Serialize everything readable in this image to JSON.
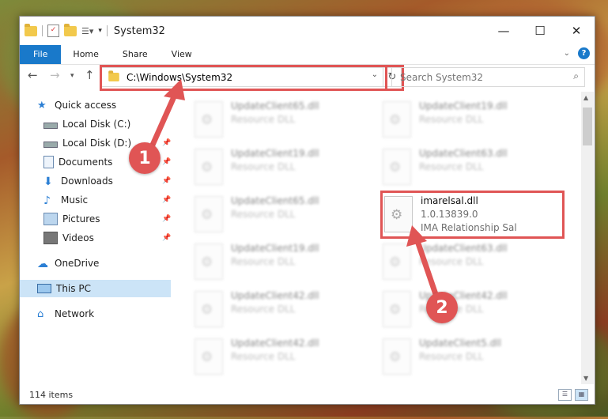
{
  "window": {
    "title": "System32"
  },
  "ribbon": {
    "tabs": [
      "File",
      "Home",
      "Share",
      "View"
    ]
  },
  "address": {
    "path": "C:\\Windows\\System32"
  },
  "search": {
    "placeholder": "Search System32"
  },
  "sidebar": {
    "items": [
      {
        "label": "Quick access",
        "icon": "star-icon"
      },
      {
        "label": "Local Disk (C:)",
        "icon": "drive-icon"
      },
      {
        "label": "Local Disk (D:)",
        "icon": "drive-icon"
      },
      {
        "label": "Documents",
        "icon": "documents-icon"
      },
      {
        "label": "Downloads",
        "icon": "download-icon"
      },
      {
        "label": "Music",
        "icon": "music-icon"
      },
      {
        "label": "Pictures",
        "icon": "pictures-icon"
      },
      {
        "label": "Videos",
        "icon": "videos-icon"
      },
      {
        "label": "OneDrive",
        "icon": "cloud-icon"
      },
      {
        "label": "This PC",
        "icon": "computer-icon"
      },
      {
        "label": "Network",
        "icon": "network-icon"
      }
    ]
  },
  "files": [
    {
      "name": "UpdateClient65.dll",
      "type": "Resource DLL"
    },
    {
      "name": "UpdateClient19.dll",
      "type": "Resource DLL"
    },
    {
      "name": "UpdateClient19.dll",
      "type": "Resource DLL"
    },
    {
      "name": "UpdateClient63.dll",
      "type": "Resource DLL"
    },
    {
      "name": "UpdateClient65.dll",
      "type": "Resource DLL"
    },
    {
      "name": "UpdateClient19.dll",
      "type": "Resource DLL"
    },
    {
      "name": "UpdateClient63.dll",
      "type": "Resource DLL"
    },
    {
      "name": "UpdateClient42.dll",
      "type": "Resource DLL"
    },
    {
      "name": "UpdateClient42.dll",
      "type": "Resource DLL"
    },
    {
      "name": "UpdateClient42.dll",
      "type": "Resource DLL"
    },
    {
      "name": "UpdateClient5.dll",
      "type": "Resource DLL"
    }
  ],
  "highlighted_file": {
    "name": "imarelsal.dll",
    "version": "1.0.13839.0",
    "description": "IMA Relationship Sal"
  },
  "status": {
    "item_count": "114 items"
  },
  "annotations": {
    "badge1": "1",
    "badge2": "2"
  },
  "colors": {
    "accent": "#1979ca",
    "annotation": "#e05555"
  }
}
